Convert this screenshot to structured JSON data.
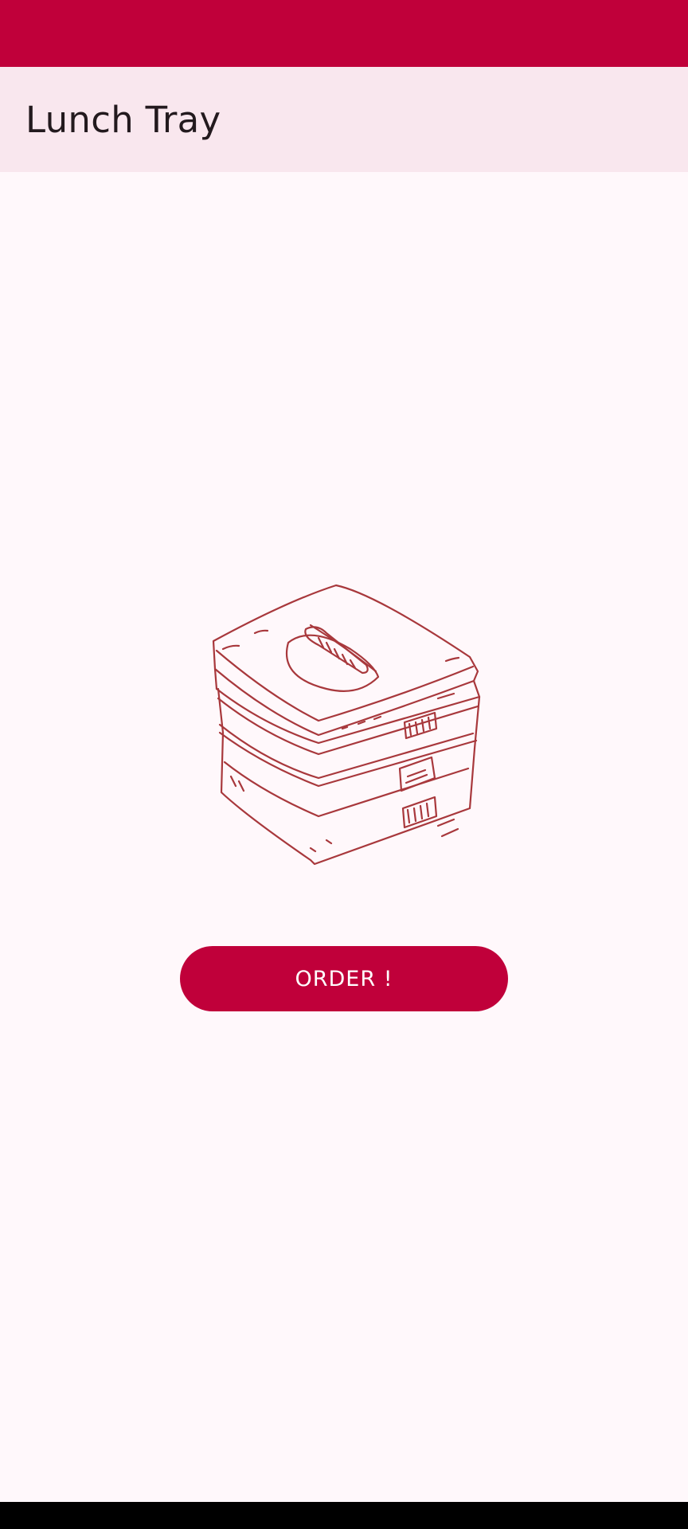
{
  "app_bar": {
    "title": "Lunch Tray"
  },
  "main": {
    "illustration_icon": "lunch-box-stack-icon",
    "order_button_label": "ORDER !"
  },
  "colors": {
    "primary": "#C0003A",
    "app_bar_background": "#F9E7EE",
    "page_background": "#FFF8FB",
    "illustration_stroke": "#A8383C",
    "title_text": "#231A1E"
  }
}
